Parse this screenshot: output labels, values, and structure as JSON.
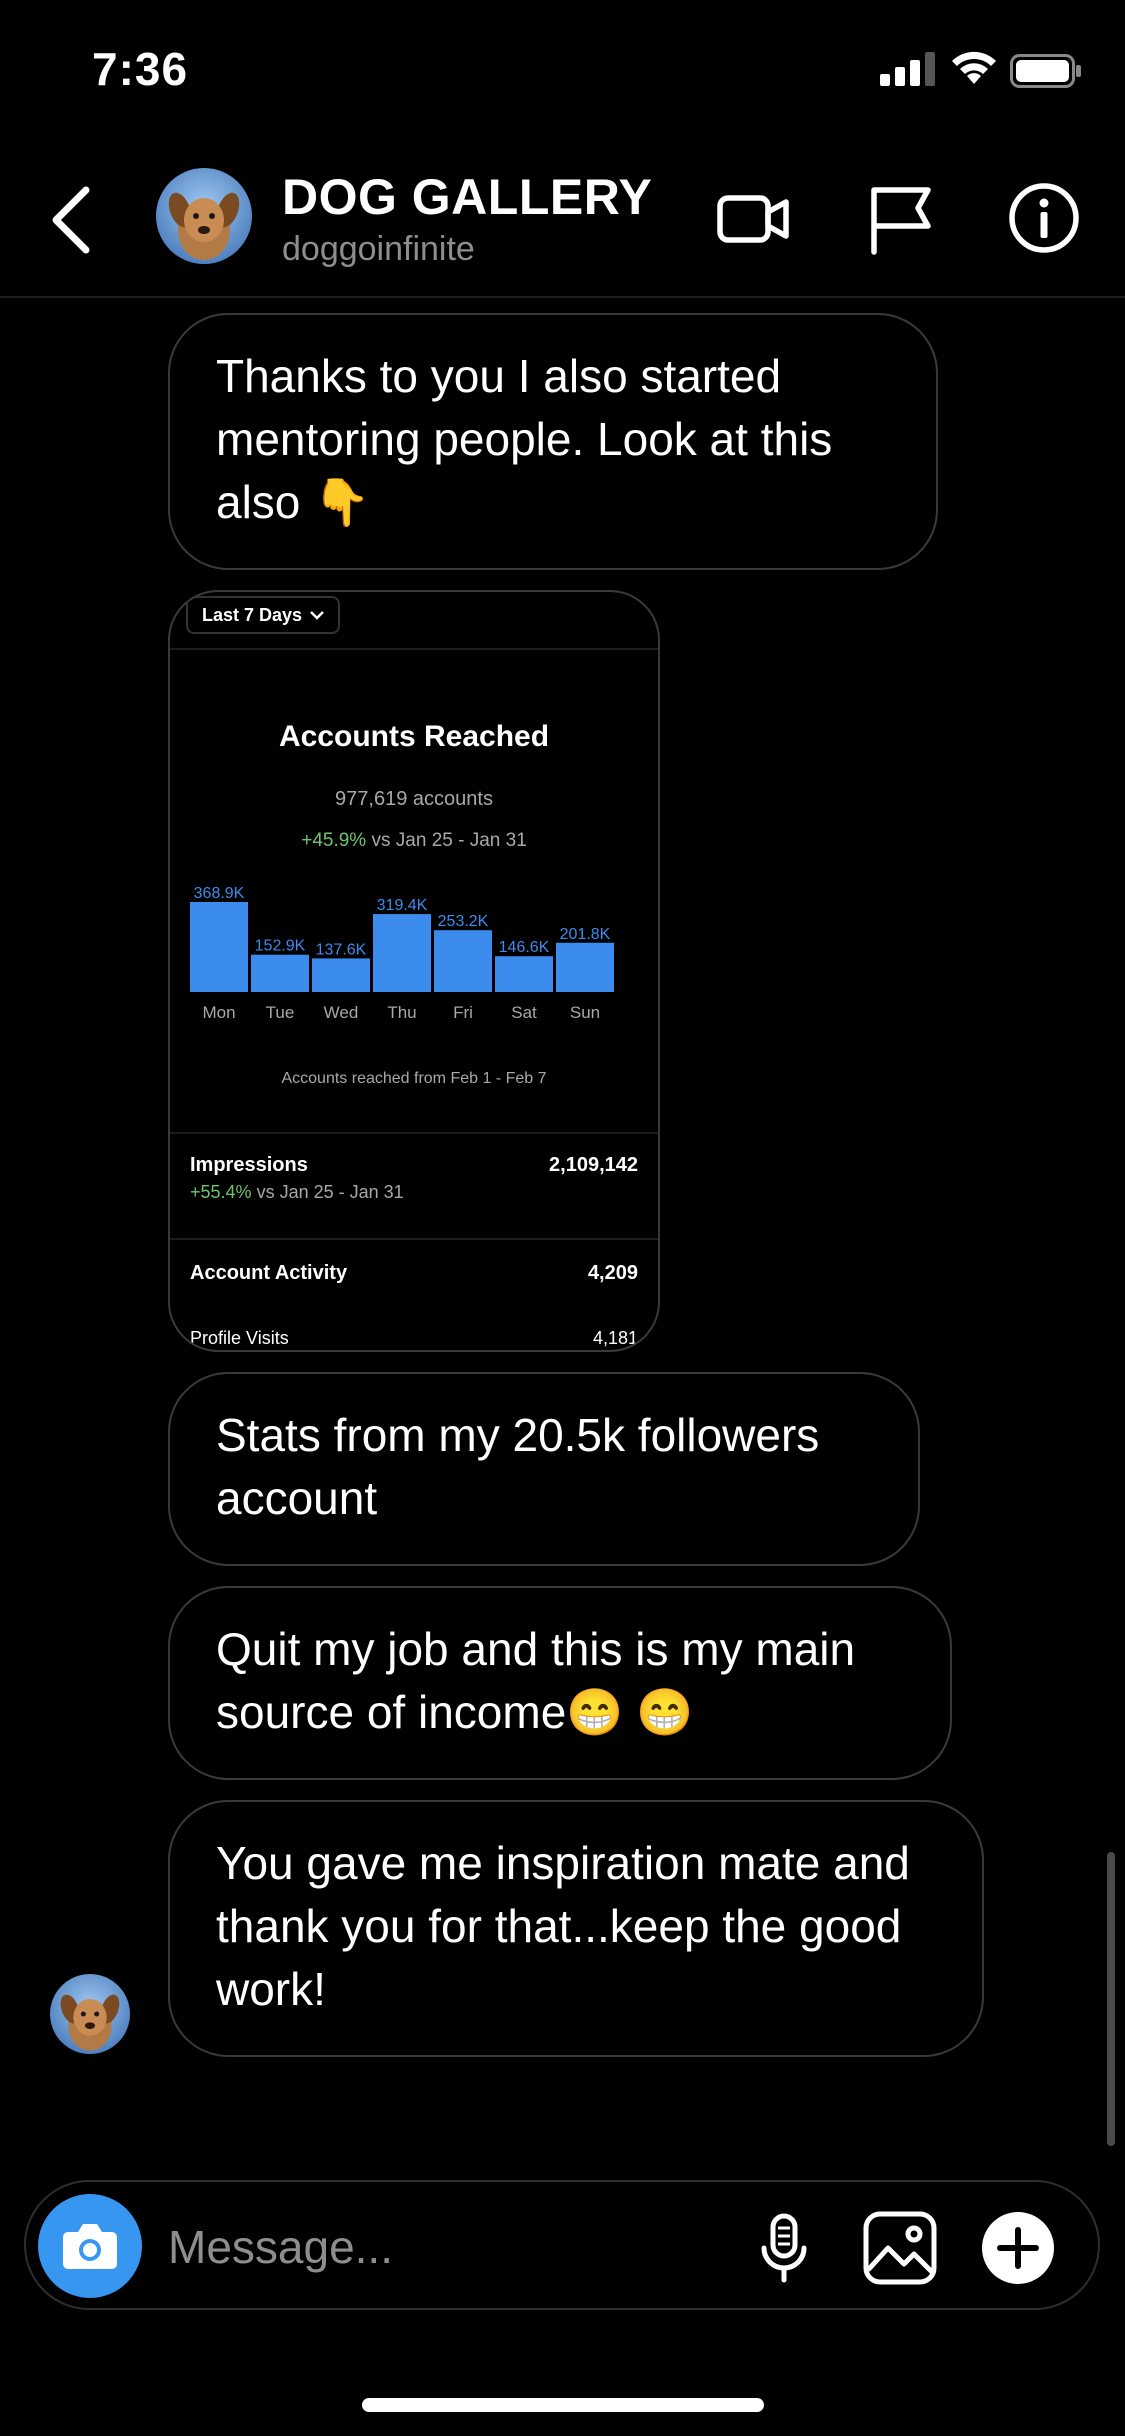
{
  "status_bar": {
    "time": "7:36"
  },
  "header": {
    "title": "DOG GALLERY",
    "username": "doggoinfinite"
  },
  "messages": [
    {
      "text": "Thanks to you I also started mentoring people. Look at this also 👇"
    },
    {
      "text": "Stats from my 20.5k followers account"
    },
    {
      "text": "Quit my job and this is my main source of income😁 😁"
    },
    {
      "text": "You gave me inspiration mate and thank you for that...keep the good work!"
    }
  ],
  "shared_image": {
    "range_label": "Last 7 Days",
    "title": "Accounts Reached",
    "subtitle": "977,619 accounts",
    "delta_value": "+45.9%",
    "delta_range": "vs Jan 25 - Jan 31",
    "footnote": "Accounts reached from Feb 1 - Feb 7",
    "impressions": {
      "label": "Impressions",
      "value": "2,109,142",
      "delta_value": "+55.4%",
      "delta_range": "vs Jan 25 - Jan 31"
    },
    "account_activity": {
      "label": "Account Activity",
      "value": "4,209"
    },
    "profile_visits": {
      "label": "Profile Visits",
      "value": "4,181"
    }
  },
  "chart_data": {
    "type": "bar",
    "categories": [
      "Mon",
      "Tue",
      "Wed",
      "Thu",
      "Fri",
      "Sat",
      "Sun"
    ],
    "values": [
      368.9,
      152.9,
      137.6,
      319.4,
      253.2,
      146.6,
      201.8
    ],
    "value_labels": [
      "368.9K",
      "152.9K",
      "137.6K",
      "319.4K",
      "253.2K",
      "146.6K",
      "201.8K"
    ],
    "title": "Accounts Reached",
    "xlabel": "",
    "ylabel": "",
    "bar_color": "#3b8ced",
    "grid": false
  },
  "composer": {
    "placeholder": "Message..."
  },
  "icons": {
    "back": "chevron-left-icon",
    "video": "video-camera-icon",
    "flag": "flag-icon",
    "info": "info-icon",
    "camera": "camera-icon",
    "mic": "microphone-icon",
    "gallery": "image-icon",
    "plus": "plus-icon"
  },
  "colors": {
    "background": "#000000",
    "accent": "#3797f0",
    "positive": "#6cc56c",
    "muted": "#8e8e8e"
  }
}
